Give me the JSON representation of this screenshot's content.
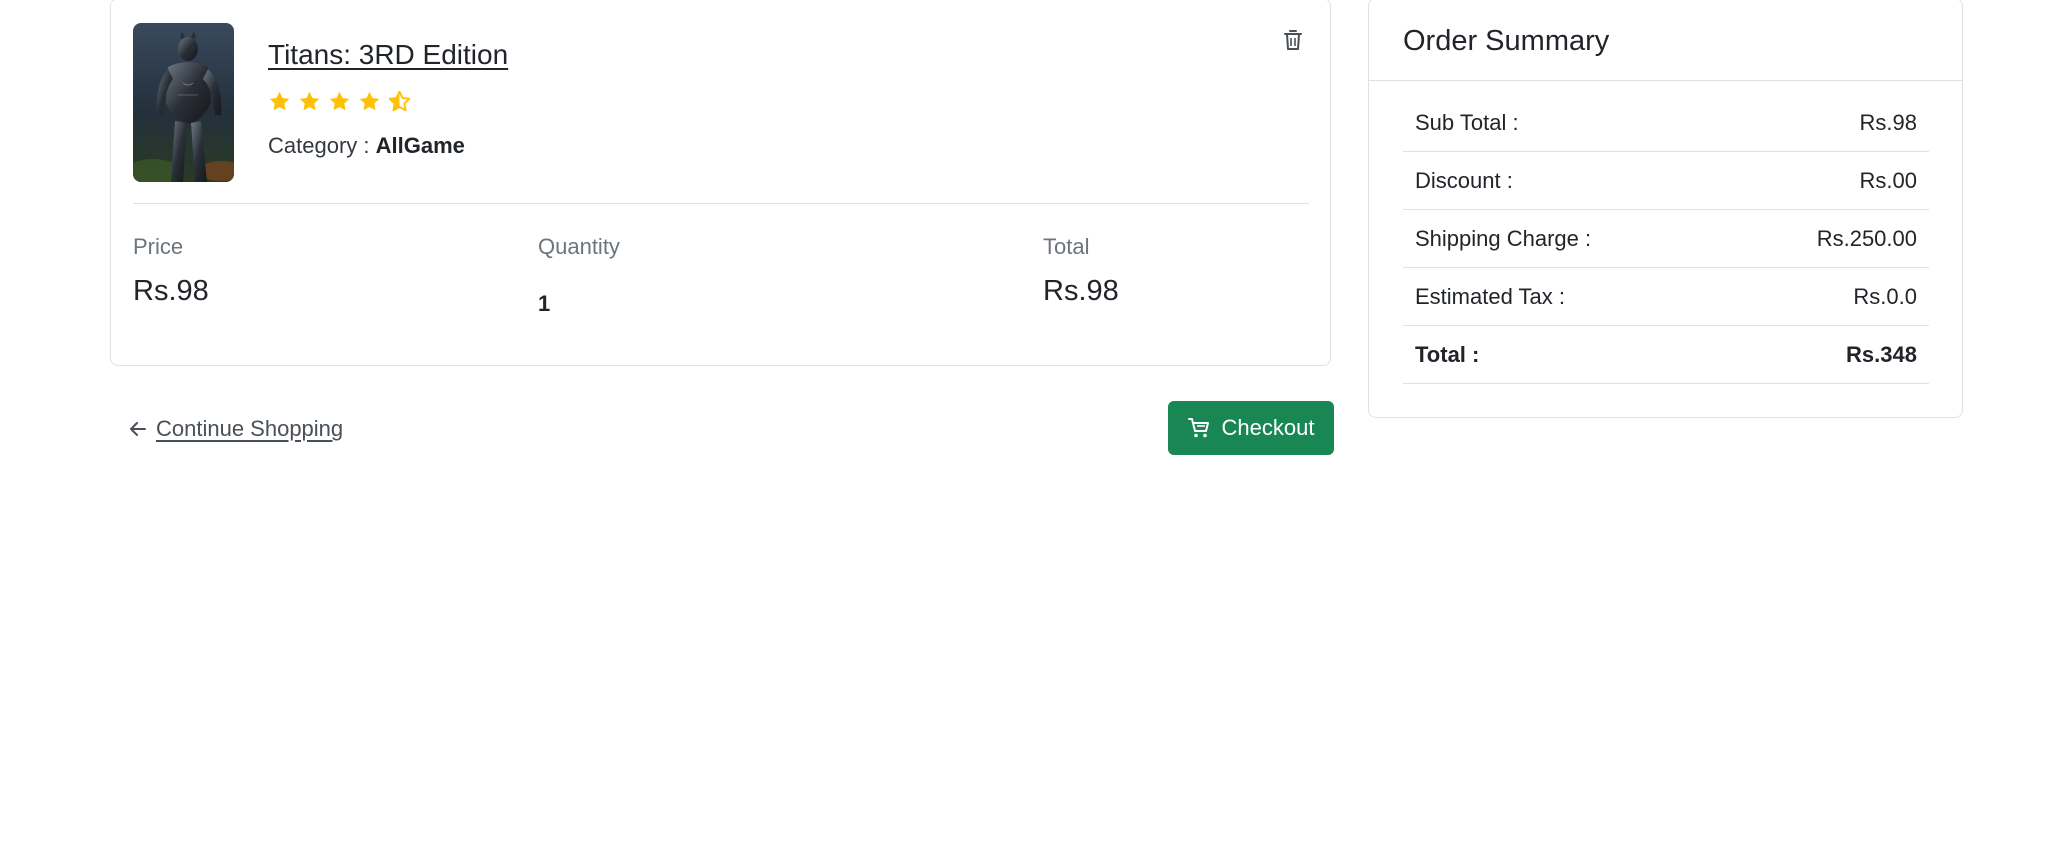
{
  "product": {
    "title": "Titans: 3RD Edition",
    "rating": 4.5,
    "category_label": "Category : ",
    "category_value": "AllGame",
    "price_label": "Price",
    "price": "Rs.98",
    "quantity_label": "Quantity",
    "quantity": "1",
    "total_label": "Total",
    "total": "Rs.98",
    "icons": {
      "delete": "trash-icon",
      "star": "star-icon"
    }
  },
  "actions": {
    "continue_label": " Continue Shopping",
    "checkout_label": "Checkout",
    "icons": {
      "continue": "arrow-left-icon",
      "checkout": "cart-icon"
    },
    "checkout_color": "#198754"
  },
  "summary": {
    "title": "Order Summary",
    "rows": [
      {
        "label": "Sub Total :",
        "value": "Rs.98"
      },
      {
        "label": "Discount :",
        "value": "Rs.00"
      },
      {
        "label": "Shipping Charge :",
        "value": "Rs.250.00"
      },
      {
        "label": "Estimated Tax :",
        "value": "Rs.0.0"
      },
      {
        "label": "Total :",
        "value": "Rs.348"
      }
    ]
  },
  "colors": {
    "star": "#ffc107",
    "border": "#dee2e6",
    "muted_text": "#6c757d"
  }
}
